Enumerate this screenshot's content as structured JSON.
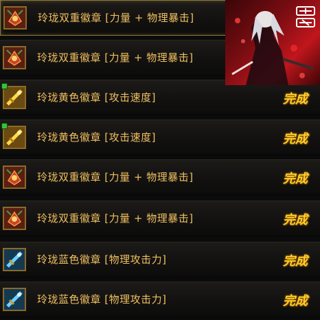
{
  "badges": [
    {
      "name": "玲珑双重徽章 [力量 + 物理暴击]",
      "status": "",
      "icon": "dual-badge-icon",
      "color": "#b23a22"
    },
    {
      "name": "玲珑双重徽章 [力量 + 物理暴击]",
      "status": "",
      "icon": "dual-badge-icon",
      "color": "#b23a22"
    },
    {
      "name": "玲珑黄色徽章 [攻击速度]",
      "status": "完成",
      "icon": "yellow-badge-icon",
      "color": "#d8a020"
    },
    {
      "name": "玲珑黄色徽章 [攻击速度]",
      "status": "完成",
      "icon": "yellow-badge-icon",
      "color": "#d8a020"
    },
    {
      "name": "玲珑双重徽章 [力量 + 物理暴击]",
      "status": "完成",
      "icon": "dual-badge-icon",
      "color": "#b23a22"
    },
    {
      "name": "玲珑双重徽章 [力量 + 物理暴击]",
      "status": "完成",
      "icon": "dual-badge-icon",
      "color": "#b23a22"
    },
    {
      "name": "玲珑蓝色徽章 [物理攻击力]",
      "status": "完成",
      "icon": "blue-badge-icon",
      "color": "#2f7fb8"
    },
    {
      "name": "玲珑蓝色徽章 [物理攻击力]",
      "status": "完成",
      "icon": "blue-badge-icon",
      "color": "#2f7fb8"
    }
  ],
  "promo": {
    "icon": "game-promo-art",
    "logo_icon": "game-logo-icon"
  }
}
